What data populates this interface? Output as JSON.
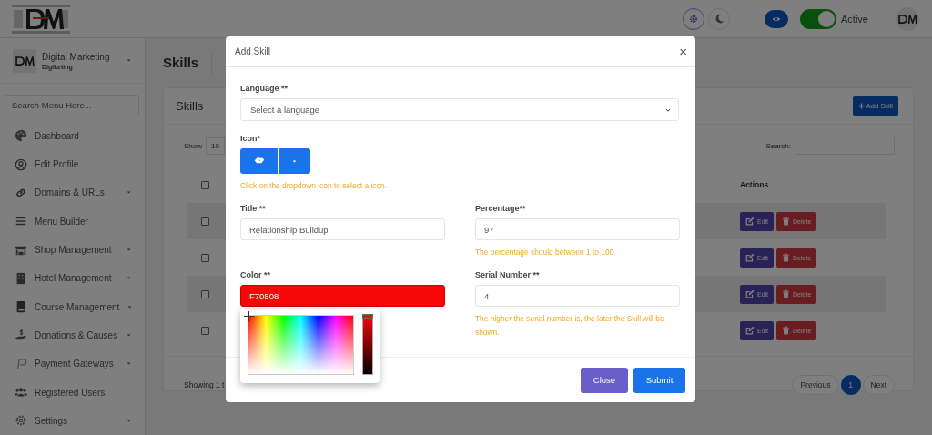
{
  "header": {
    "status_toggle": {
      "on": true,
      "label": "Active"
    }
  },
  "sidebar": {
    "profile": {
      "name": "Digital Marketing",
      "subtitle": "Digiketing"
    },
    "search": {
      "placeholder": "Search Menu Here..."
    },
    "items": [
      {
        "label": "Dashboard",
        "expandable": false
      },
      {
        "label": "Edit Profile",
        "expandable": false
      },
      {
        "label": "Domains & URLs",
        "expandable": true
      },
      {
        "label": "Menu Builder",
        "expandable": false
      },
      {
        "label": "Shop Management",
        "expandable": true
      },
      {
        "label": "Hotel Management",
        "expandable": true
      },
      {
        "label": "Course Management",
        "expandable": true
      },
      {
        "label": "Donations & Causes",
        "expandable": true
      },
      {
        "label": "Payment Gateways",
        "expandable": true
      },
      {
        "label": "Registered Users",
        "expandable": false
      },
      {
        "label": "Settings",
        "expandable": true
      }
    ]
  },
  "page": {
    "title": "Skills",
    "card": {
      "title": "Skills",
      "add_button": "Add Skill",
      "length_label": "Show",
      "length_value": "10",
      "search_label": "Search:",
      "table": {
        "header_checked": false,
        "actions_heading": "Actions",
        "rows": [
          {
            "checked": false,
            "edit": "Edit",
            "delete": "Delete"
          },
          {
            "checked": false,
            "edit": "Edit",
            "delete": "Delete"
          },
          {
            "checked": false,
            "edit": "Edit",
            "delete": "Delete"
          },
          {
            "checked": false,
            "edit": "Edit",
            "delete": "Delete"
          }
        ]
      },
      "info": "Showing 1 t",
      "pagination": {
        "previous": "Previous",
        "pages": [
          {
            "label": "1",
            "selected": true
          }
        ],
        "next": "Next"
      }
    }
  },
  "modal": {
    "title": "Add Skill",
    "close": "×",
    "language": {
      "label": "Language **",
      "value": "Select a language"
    },
    "icon": {
      "label": "Icon*",
      "hint": "Click on the dropdown icon to select a icon."
    },
    "title_field": {
      "label": "Title **",
      "value": "Relationship Buildup"
    },
    "percentage": {
      "label": "Percentage**",
      "value": "97",
      "hint": "The percentage should between 1 to 100."
    },
    "color": {
      "label": "Color **",
      "value": "F70808",
      "picker_open": true,
      "level": 1
    },
    "serial": {
      "label": "Serial Number **",
      "value": "4",
      "hint": "The higher the serial number is, the later the Skill will be shown."
    },
    "buttons": [
      {
        "label": "Close",
        "kind": "secondary"
      },
      {
        "label": "Submit",
        "kind": "primary"
      }
    ]
  }
}
